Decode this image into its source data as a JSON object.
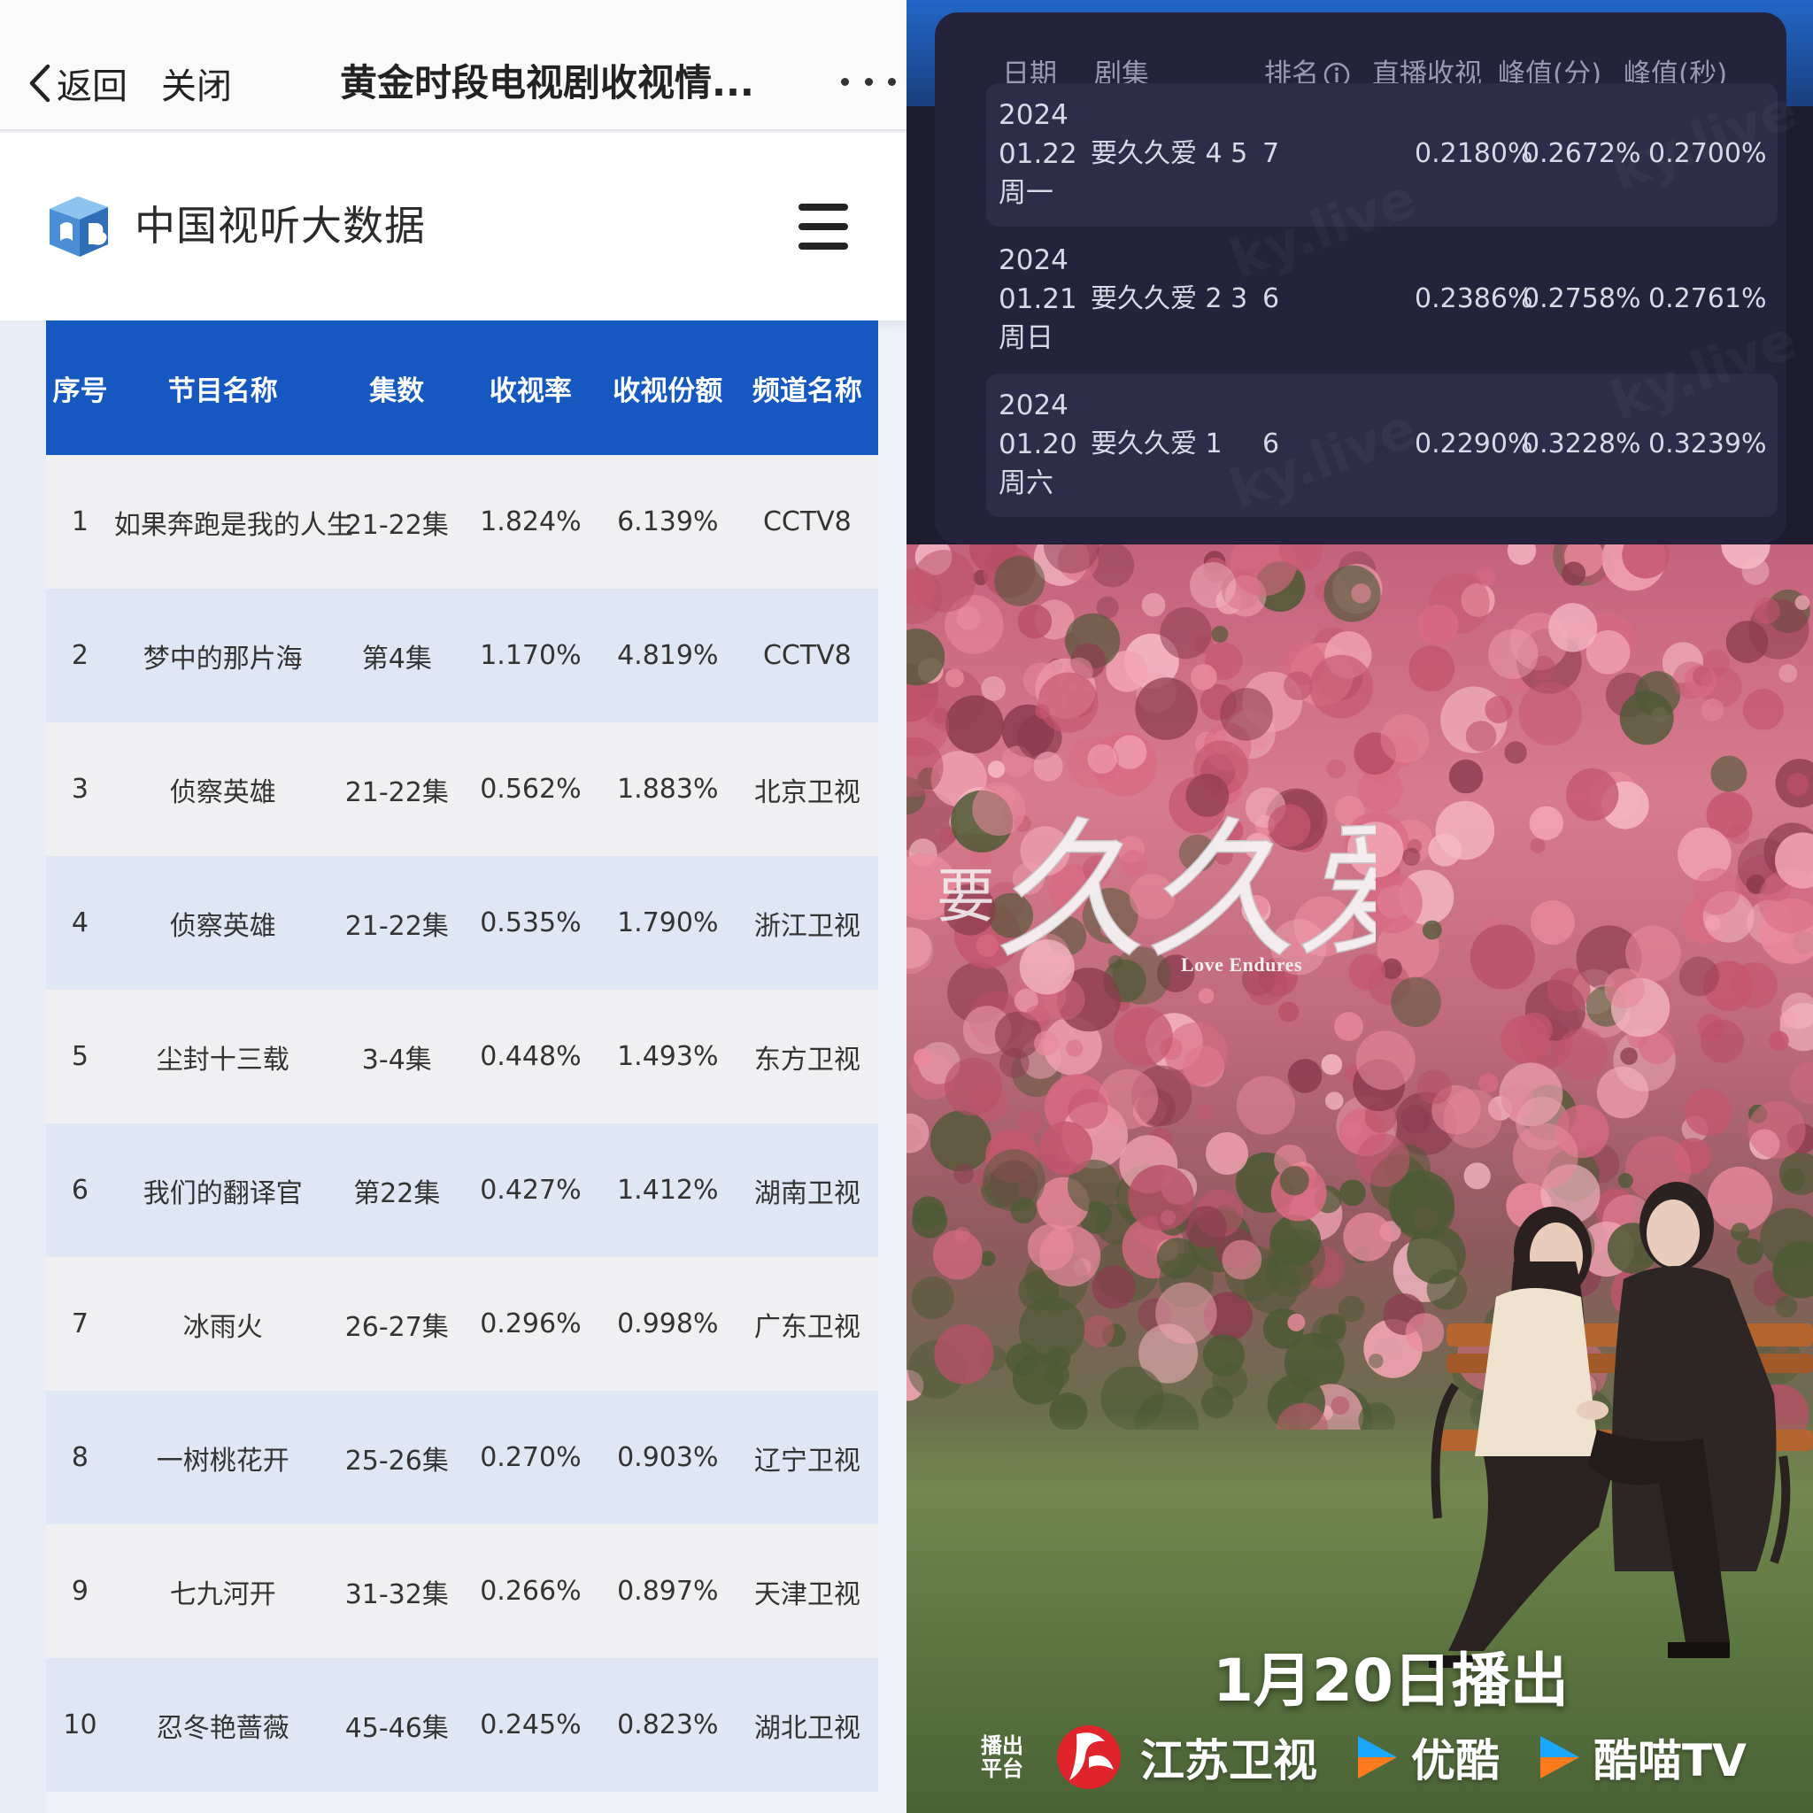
{
  "topbar": {
    "back_label": "返回",
    "close_label": "关闭",
    "title": "黄金时段电视剧收视情...",
    "more_icon": "more-dots-icon"
  },
  "brand": {
    "name": "中国视听大数据",
    "logo_icon": "cvb-logo-icon",
    "menu_icon": "hamburger-menu-icon",
    "accent_color": "#1558c0"
  },
  "rating_table": {
    "headers": [
      "序号",
      "节目名称",
      "集数",
      "收视率",
      "收视份额",
      "频道名称"
    ],
    "rows": [
      {
        "no": "1",
        "name": "如果奔跑是我的人生",
        "episodes": "21-22集",
        "rating": "1.824%",
        "share": "6.139%",
        "channel": "CCTV8"
      },
      {
        "no": "2",
        "name": "梦中的那片海",
        "episodes": "第4集",
        "rating": "1.170%",
        "share": "4.819%",
        "channel": "CCTV8"
      },
      {
        "no": "3",
        "name": "侦察英雄",
        "episodes": "21-22集",
        "rating": "0.562%",
        "share": "1.883%",
        "channel": "北京卫视"
      },
      {
        "no": "4",
        "name": "侦察英雄",
        "episodes": "21-22集",
        "rating": "0.535%",
        "share": "1.790%",
        "channel": "浙江卫视"
      },
      {
        "no": "5",
        "name": "尘封十三载",
        "episodes": "3-4集",
        "rating": "0.448%",
        "share": "1.493%",
        "channel": "东方卫视"
      },
      {
        "no": "6",
        "name": "我们的翻译官",
        "episodes": "第22集",
        "rating": "0.427%",
        "share": "1.412%",
        "channel": "湖南卫视"
      },
      {
        "no": "7",
        "name": "冰雨火",
        "episodes": "26-27集",
        "rating": "0.296%",
        "share": "0.998%",
        "channel": "广东卫视"
      },
      {
        "no": "8",
        "name": "一树桃花开",
        "episodes": "25-26集",
        "rating": "0.270%",
        "share": "0.903%",
        "channel": "辽宁卫视"
      },
      {
        "no": "9",
        "name": "七九河开",
        "episodes": "31-32集",
        "rating": "0.266%",
        "share": "0.897%",
        "channel": "天津卫视"
      },
      {
        "no": "10",
        "name": "忍冬艳蔷薇",
        "episodes": "45-46集",
        "rating": "0.245%",
        "share": "0.823%",
        "channel": "湖北卫视"
      }
    ]
  },
  "ratings_detail": {
    "headers": {
      "date": "日期",
      "series": "剧集",
      "rank": "排名",
      "live": "直播收视",
      "peak_min": "峰值(分)",
      "peak_sec": "峰值(秒)"
    },
    "info_icon": "info-circle-icon",
    "watermark": "ky.live",
    "rows": [
      {
        "year": "2024",
        "date": "01.22",
        "weekday": "周一",
        "series": "要久久爱 4 5",
        "rank": "7",
        "live": "0.2180%",
        "peak_min": "0.2672%",
        "peak_sec": "0.2700%"
      },
      {
        "year": "2024",
        "date": "01.21",
        "weekday": "周日",
        "series": "要久久爱 2 3",
        "rank": "6",
        "live": "0.2386%",
        "peak_min": "0.2758%",
        "peak_sec": "0.2761%"
      },
      {
        "year": "2024",
        "date": "01.20",
        "weekday": "周六",
        "series": "要久久爱 1",
        "rank": "6",
        "live": "0.2290%",
        "peak_min": "0.3228%",
        "peak_sec": "0.3239%"
      }
    ]
  },
  "poster": {
    "title_small": "要",
    "title_large": "久久爱",
    "subtitle": "Love Endures",
    "air_date": "1月20日播出",
    "platform_label_line1": "播出",
    "platform_label_line2": "平台",
    "platforms": [
      {
        "name": "江苏卫视",
        "icon": "jiangsu-tv-logo-icon"
      },
      {
        "name": "优酷",
        "icon": "youku-logo-icon"
      },
      {
        "name": "酷喵TV",
        "icon": "kumiao-logo-icon"
      }
    ]
  }
}
